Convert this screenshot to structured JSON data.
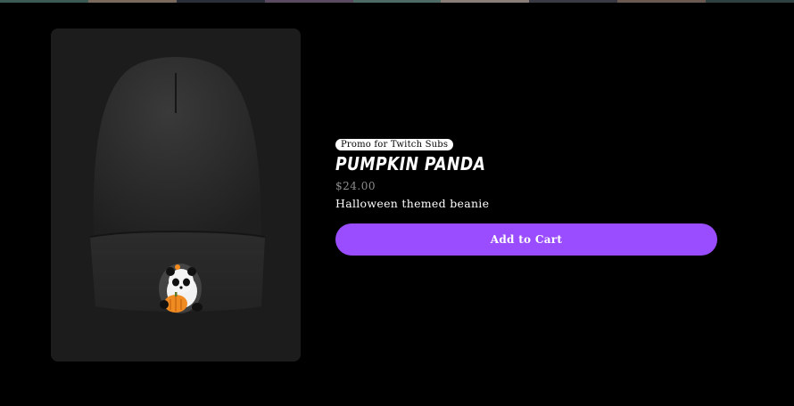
{
  "product": {
    "image_alt": "black beanie with pumpkin panda patch",
    "badge": "Promo for Twitch Subs",
    "title": "PUMPKIN PANDA",
    "price": "$24.00",
    "description": "Halloween themed beanie"
  },
  "cart": {
    "add_label": "Add to Cart"
  },
  "colors": {
    "background": "#000000",
    "card": "#1c1c1c",
    "accent": "#9a4dff",
    "badge_bg": "#ffffff",
    "price_text": "#8d8d8d"
  }
}
